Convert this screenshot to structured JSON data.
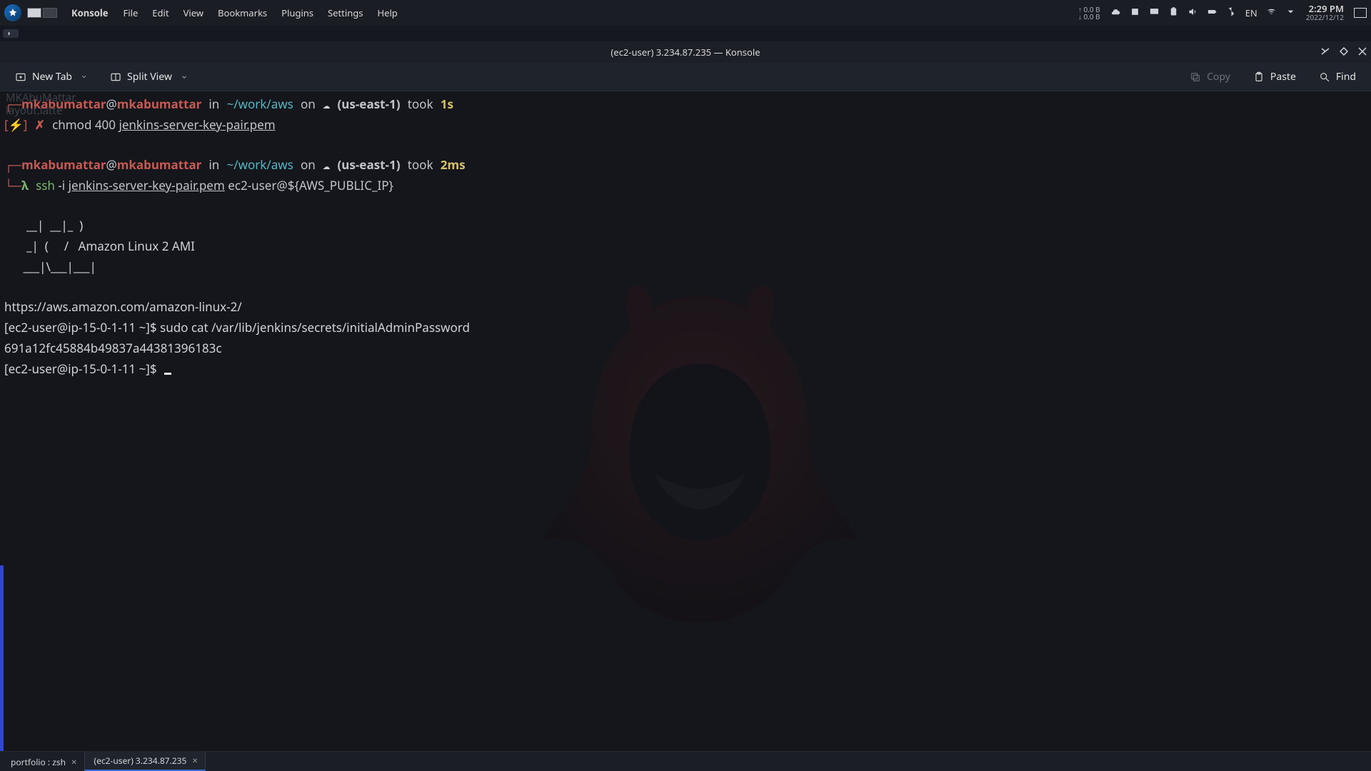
{
  "panel": {
    "app": "Konsole",
    "menus": [
      "File",
      "Edit",
      "View",
      "Bookmarks",
      "Plugins",
      "Settings",
      "Help"
    ],
    "net_up": "0.0 B",
    "net_dn": "0.0 B",
    "lang": "EN",
    "time": "2:29 PM",
    "date": "2022/12/12"
  },
  "title": "(ec2-user) 3.234.87.235 — Konsole",
  "toolbar": {
    "new_tab": "New Tab",
    "split": "Split View",
    "copy": "Copy",
    "paste": "Paste",
    "find": "Find"
  },
  "ghost": {
    "l1": "MKAbuMattar.",
    "l2": "layout.latte"
  },
  "prompt": {
    "user": "mkabumattar",
    "host": "mkabumattar",
    "path": "~/work/aws",
    "region": "(us-east-1)",
    "took1": "1s",
    "took2": "2ms",
    "cmd1_a": "chmod 400 ",
    "cmd1_b": "jenkins-server-key-pair.pem",
    "cmd2_a": "ssh",
    "cmd2_b": " -i ",
    "cmd2_c": "jenkins-server-key-pair.pem",
    "cmd2_d": " ec2-user@${AWS_PUBLIC_IP}"
  },
  "motd": {
    "l1": "       __|  __|_  )",
    "l2": "       _|  (     /   Amazon Linux 2 AMI",
    "l3": "      ___|\\___|___|",
    "url": "https://aws.amazon.com/amazon-linux-2/"
  },
  "session": {
    "ps1": "[ec2-user@ip-15-0-1-11 ~]$ ",
    "cmd": "sudo cat /var/lib/jenkins/secrets/initialAdminPassword",
    "out": "691a12fc45884b49837a44381396183c"
  },
  "tabs": [
    {
      "label": "portfolio : zsh",
      "active": false
    },
    {
      "label": "(ec2-user) 3.234.87.235",
      "active": true
    }
  ]
}
